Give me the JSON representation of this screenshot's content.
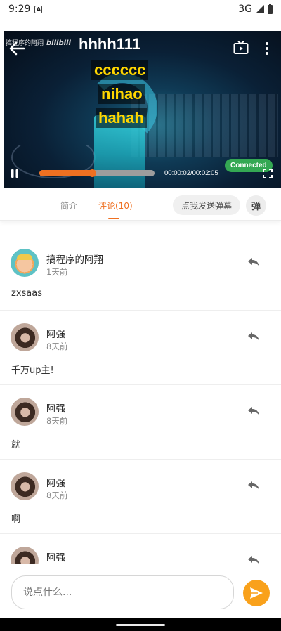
{
  "status_bar": {
    "time": "9:29",
    "network": "3G",
    "notification_icon": "a-icon"
  },
  "video": {
    "title": "hhhh111",
    "watermark_author": "搞程序的阿翔",
    "watermark_brand": "bilibili",
    "danmaku": [
      "cccccc",
      "nihao",
      "hahah"
    ],
    "progress_fraction": 0.46,
    "current_time": "00:00:02",
    "duration": "00:02:05",
    "time_text": "00:00:02/00:02:05",
    "cast_status": "Connected",
    "colors": {
      "accent": "#ef7021",
      "danmaku": "#ffd600",
      "cast": "#34a853"
    }
  },
  "tabs": {
    "intro": "简介",
    "comments": "评论(10)",
    "send_danmaku": "点我发送弹幕",
    "danmaku_toggle": "弹"
  },
  "comments": [
    {
      "user": "搞程序的阿翔",
      "time": "1天前",
      "text": "zxsaas",
      "avatar": "cartoon"
    },
    {
      "user": "阿强",
      "time": "8天前",
      "text": "千万up主!",
      "avatar": "photo"
    },
    {
      "user": "阿强",
      "time": "8天前",
      "text": "就",
      "avatar": "photo"
    },
    {
      "user": "阿强",
      "time": "8天前",
      "text": "啊",
      "avatar": "photo"
    },
    {
      "user": "阿强",
      "time": "",
      "text": "",
      "avatar": "photo"
    }
  ],
  "input": {
    "placeholder": "说点什么..."
  },
  "colors": {
    "send_button": "#f9a11b"
  }
}
